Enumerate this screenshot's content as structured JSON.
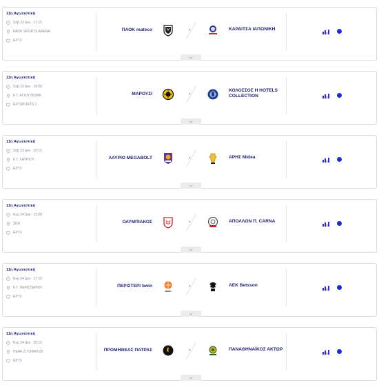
{
  "matches": [
    {
      "round": "11η Αγωνιστική",
      "datetime": "Σαβ 23 Δεκ - 17:15",
      "venue": "PAOK SPORTS ARENA",
      "tv": "ΕΡΤ3",
      "home": "ΠΑΟΚ mateco",
      "away": "ΚΑΡΔΙΤΣΑ ΙΑΠΩΝΙΚΗ",
      "score_separator": "-",
      "home_logo": "paok-logo",
      "away_logo": "karditsa-logo"
    },
    {
      "round": "11η Αγωνιστική",
      "datetime": "Σαβ 23 Δεκ - 18:00",
      "venue": "Κ.Γ. ΑΓΙΟΥ ΘΩΜΑ",
      "tv": "ΕΡΤSPORTS 1",
      "home": "ΜΑΡΟΥΣΙ",
      "away": "ΚΟΛΟΣΣΟΣ H HOTELS COLLECTION",
      "score_separator": "-",
      "home_logo": "maroussi-logo",
      "away_logo": "kolossos-logo"
    },
    {
      "round": "11η Αγωνιστική",
      "datetime": "Σαβ 23 Δεκ - 20:15",
      "venue": "Κ.Γ. ΛΑΥΡΙΟΥ",
      "tv": "ΕΡΤ3",
      "home": "ΛΑΥΡΙΟ MEGABOLT",
      "away": "ΑΡΗΣ Midea",
      "score_separator": "-",
      "home_logo": "lavrio-logo",
      "away_logo": "aris-logo"
    },
    {
      "round": "11η Αγωνιστική",
      "datetime": "Κυρ 24 Δεκ - 15:00",
      "venue": "ΣΕΦ",
      "tv": "ΕΡΤ3",
      "home": "ΟΛΥΜΠΙΑΚΟΣ",
      "away": "ΑΠΟΛΛΩΝ Π. CARNA",
      "score_separator": "-",
      "home_logo": "olympiacos-logo",
      "away_logo": "apollon-logo"
    },
    {
      "round": "11η Αγωνιστική",
      "datetime": "Κυρ 24 Δεκ - 17:15",
      "venue": "Κ.Γ. ΠΕΡΙΣΤΕΡΙΟΥ",
      "tv": "ΕΡΤ3",
      "home": "ΠΕΡΙΣΤΕΡΙ bwin",
      "away": "ΑΕΚ Betsson",
      "score_separator": "-",
      "home_logo": "peristeri-logo",
      "away_logo": "aek-logo"
    },
    {
      "round": "11η Αγωνιστική",
      "datetime": "Κυρ 24 Δεκ - 20:15",
      "venue": "ΠΕΑΚ Δ.ΤΟΦΑΛΟΣ",
      "tv": "ΕΡΤ3",
      "home": "ΠΡΟΜΗΘΕΑΣ ΠΑΤΡΑΣ",
      "away": "ΠΑΝΑΘΗΝΑΪΚΟΣ ΑΚΤΩΡ",
      "score_separator": "-",
      "home_logo": "promitheas-logo",
      "away_logo": "panathinaikos-logo"
    }
  ],
  "colors": {
    "accent": "#1f2bd6",
    "text": "#1e1e6e",
    "muted": "#8a8a9a",
    "border": "#dcdcdc"
  },
  "icons": {
    "date": "clock-icon",
    "venue": "location-pin-icon",
    "tv": "tv-icon",
    "stats": "bar-chart-icon",
    "live": "live-dot",
    "expand": "chevron-down-icon"
  }
}
